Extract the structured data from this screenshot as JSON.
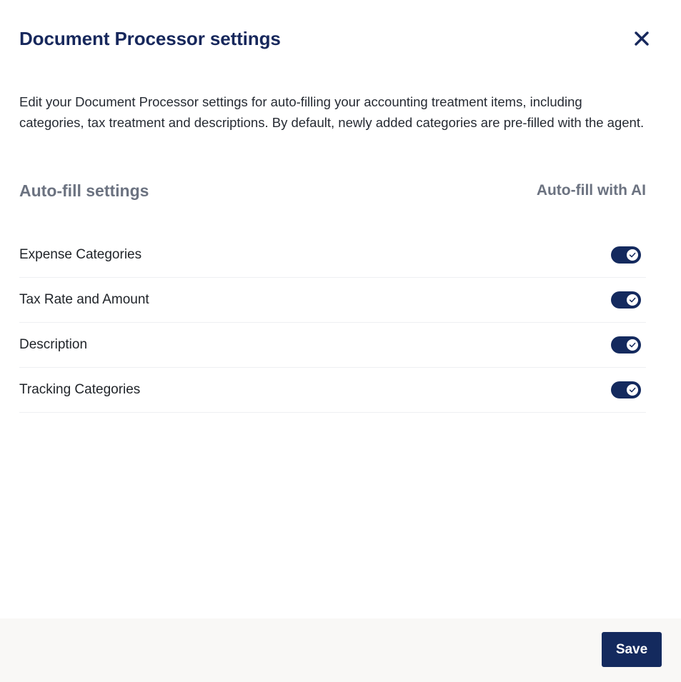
{
  "dialog": {
    "title": "Document Processor settings",
    "close_icon": "close-icon",
    "description": "Edit your Document Processor settings for auto-filling your accounting treatment items, including categories, tax treatment and descriptions. By default, newly added categories are pre-filled with the agent."
  },
  "section": {
    "title": "Auto-fill settings",
    "column_label": "Auto-fill with AI"
  },
  "settings": [
    {
      "label": "Expense Categories",
      "enabled": true
    },
    {
      "label": "Tax Rate and Amount",
      "enabled": true
    },
    {
      "label": "Description",
      "enabled": true
    },
    {
      "label": "Tracking Categories",
      "enabled": true
    }
  ],
  "footer": {
    "save_label": "Save"
  },
  "colors": {
    "primary": "#142a5e",
    "title": "#17285c",
    "muted": "#6b7280",
    "footer_bg": "#f9f8f6"
  }
}
